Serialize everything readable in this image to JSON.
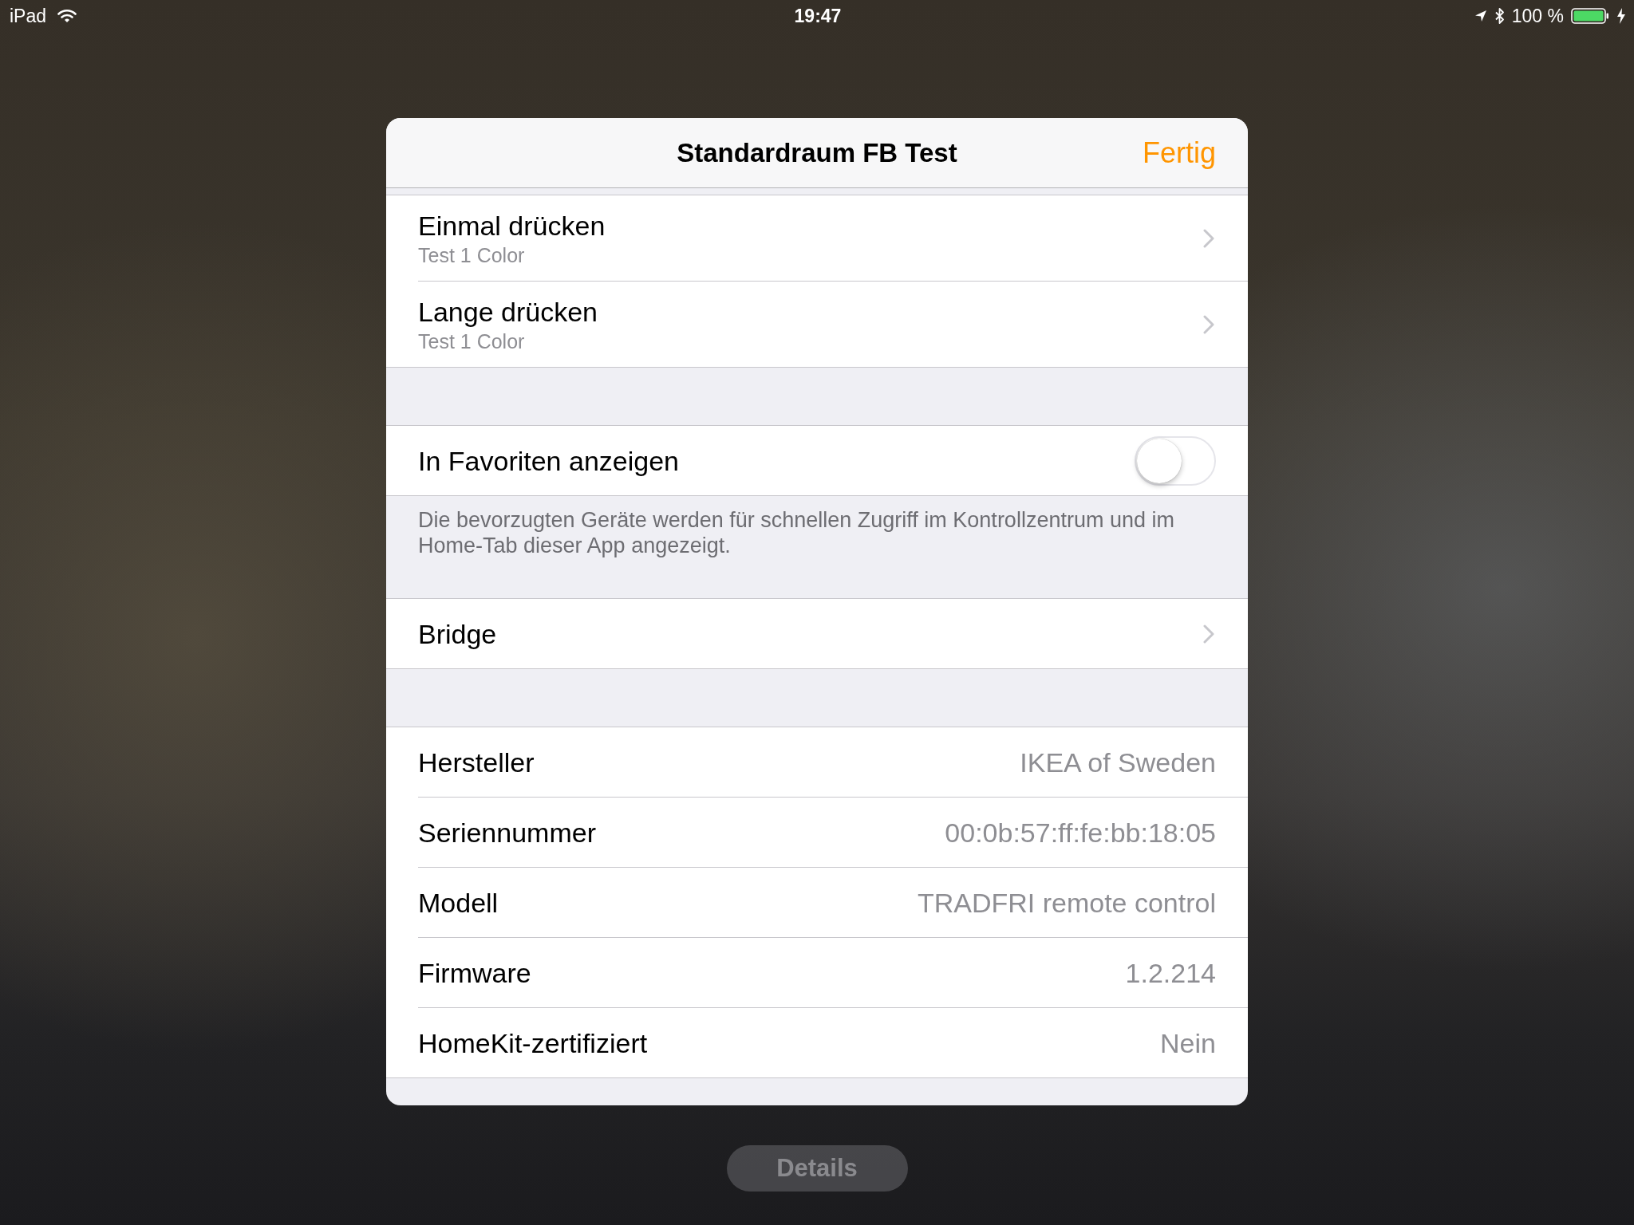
{
  "status_bar": {
    "device": "iPad",
    "time": "19:47",
    "battery_percent": "100 %"
  },
  "sheet": {
    "title": "Standardraum FB Test",
    "done_button": "Fertig",
    "sections": [
      {
        "rows": [
          {
            "kind": "disclosure",
            "title": "Einmal drücken",
            "subtitle": "Test 1 Color"
          },
          {
            "kind": "disclosure",
            "title": "Lange drücken",
            "subtitle": "Test 1 Color"
          }
        ]
      },
      {
        "rows": [
          {
            "kind": "toggle",
            "title": "In Favoriten anzeigen",
            "on": false
          }
        ],
        "footer": "Die bevorzugten Geräte werden für schnellen Zugriff im Kontrollzentrum und im Home-Tab dieser App angezeigt."
      },
      {
        "rows": [
          {
            "kind": "disclosure",
            "title": "Bridge"
          }
        ]
      },
      {
        "rows": [
          {
            "kind": "info",
            "title": "Hersteller",
            "value": "IKEA of Sweden"
          },
          {
            "kind": "info",
            "title": "Seriennummer",
            "value": "00:0b:57:ff:fe:bb:18:05"
          },
          {
            "kind": "info",
            "title": "Modell",
            "value": "TRADFRI remote control"
          },
          {
            "kind": "info",
            "title": "Firmware",
            "value": "1.2.214"
          },
          {
            "kind": "info",
            "title": "HomeKit-zertifiziert",
            "value": "Nein"
          }
        ]
      }
    ]
  },
  "details_button": "Details"
}
